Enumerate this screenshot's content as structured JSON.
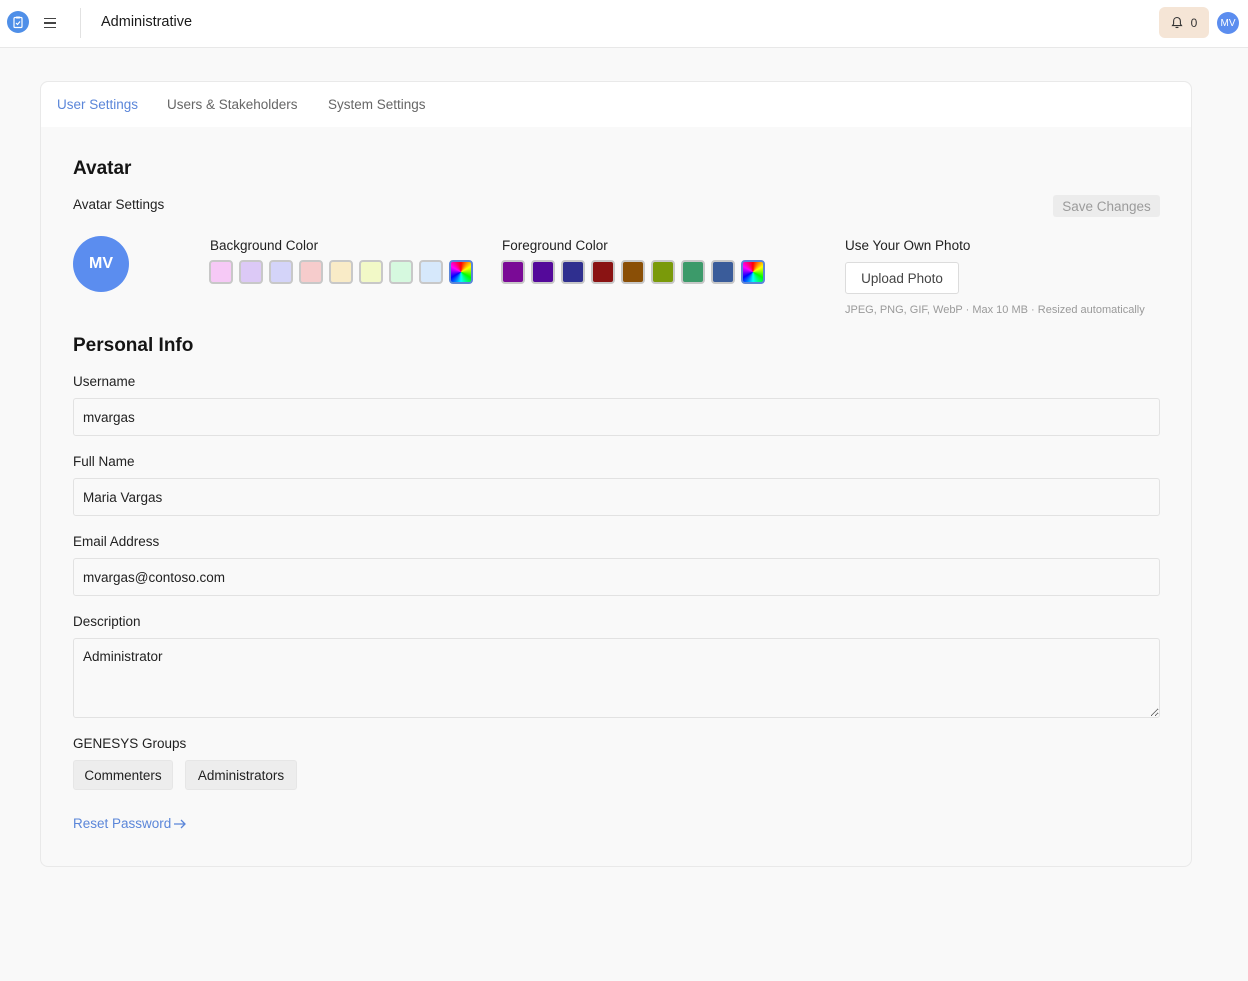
{
  "header": {
    "app_logo_icon": "clipboard-check-icon",
    "menu_icon": "hamburger-menu-icon",
    "title": "Administrative",
    "notifications": {
      "icon": "bell-icon",
      "count": "0"
    },
    "user_initials": "MV"
  },
  "tabs": [
    {
      "label": "User Settings",
      "active": true
    },
    {
      "label": "Users & Stakeholders",
      "active": false
    },
    {
      "label": "System Settings",
      "active": false
    }
  ],
  "avatar": {
    "section_title": "Avatar",
    "subtitle": "Avatar Settings",
    "save_label": "Save Changes",
    "initials": "MV",
    "background_label": "Background Color",
    "background_colors": [
      "#f6c9f6",
      "#dcc9f6",
      "#d4d4f9",
      "#f6cccc",
      "#f9ebc7",
      "#f2f9c7",
      "#d6f9df",
      "#d6e8fb",
      "custom"
    ],
    "foreground_label": "Foreground Color",
    "foreground_colors": [
      "#7a0a96",
      "#54099a",
      "#2f2f8f",
      "#8a1313",
      "#8a4f06",
      "#7a9a0a",
      "#3c9a6a",
      "#3a5c9a",
      "custom"
    ],
    "photo_label": "Use Your Own Photo",
    "upload_label": "Upload Photo",
    "upload_hint": "JPEG, PNG, GIF, WebP · Max 10 MB · Resized automatically"
  },
  "personal": {
    "section_title": "Personal Info",
    "username_label": "Username",
    "username": "mvargas",
    "fullname_label": "Full Name",
    "fullname": "Maria Vargas",
    "email_label": "Email Address",
    "email": "mvargas@contoso.com",
    "description_label": "Description",
    "description": "Administrator",
    "groups_label": "GENESYS Groups",
    "groups": [
      "Commenters",
      "Administrators"
    ],
    "reset_label": "Reset Password"
  },
  "colors": {
    "accent": "#5b86d9",
    "avatar": "#5b8def",
    "notification_bg": "#f5e5d6"
  }
}
